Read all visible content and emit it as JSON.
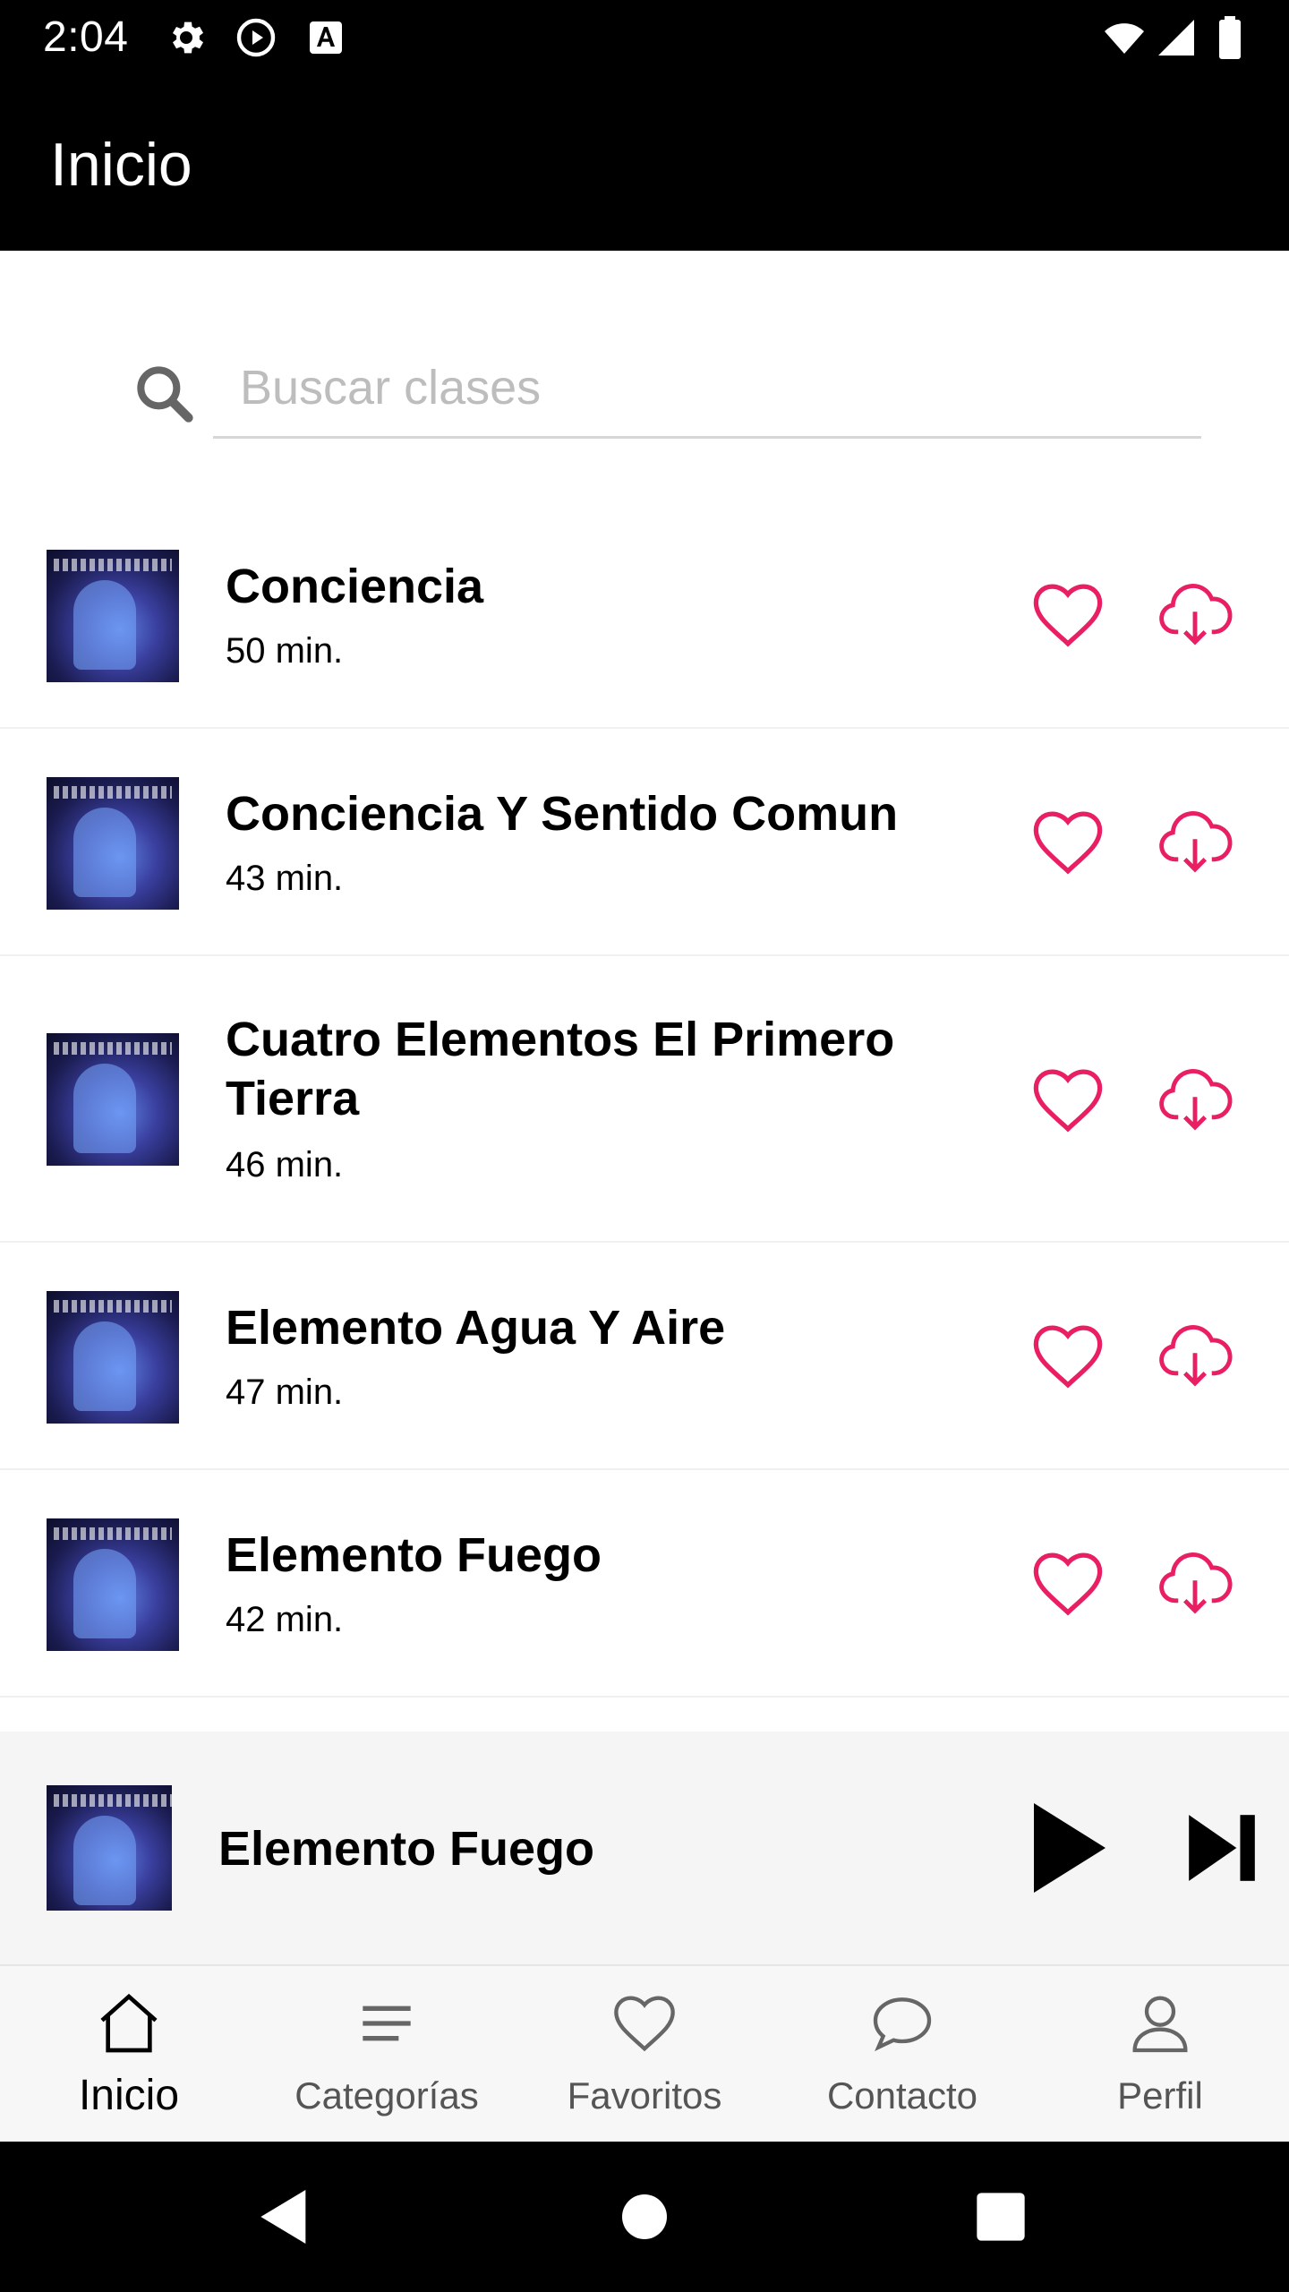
{
  "status_bar": {
    "time": "2:04",
    "icons": [
      "settings-gear-icon",
      "play-circle-icon",
      "font-a-icon",
      "wifi-icon",
      "signal-icon",
      "battery-icon"
    ]
  },
  "app_bar": {
    "title": "Inicio"
  },
  "search": {
    "placeholder": "Buscar clases",
    "value": ""
  },
  "colors": {
    "accent": "#e91e63",
    "bar_bg": "#000000",
    "player_bg": "#f5f5f5",
    "nav_bg": "#f7f7f7"
  },
  "classes": [
    {
      "title": "Conciencia",
      "duration": "50 min."
    },
    {
      "title": "Conciencia Y Sentido Comun",
      "duration": "43 min."
    },
    {
      "title": "Cuatro Elementos El Primero Tierra",
      "duration": "46 min."
    },
    {
      "title": "Elemento Agua Y Aire",
      "duration": "47 min."
    },
    {
      "title": "Elemento Fuego",
      "duration": "42 min."
    }
  ],
  "player": {
    "title": "Elemento Fuego"
  },
  "bottom_nav": {
    "items": [
      {
        "label": "Inicio",
        "icon": "home-icon",
        "active": true
      },
      {
        "label": "Categorías",
        "icon": "menu-lines-icon",
        "active": false
      },
      {
        "label": "Favoritos",
        "icon": "heart-icon",
        "active": false
      },
      {
        "label": "Contacto",
        "icon": "chat-bubble-icon",
        "active": false
      },
      {
        "label": "Perfil",
        "icon": "person-icon",
        "active": false
      }
    ]
  }
}
